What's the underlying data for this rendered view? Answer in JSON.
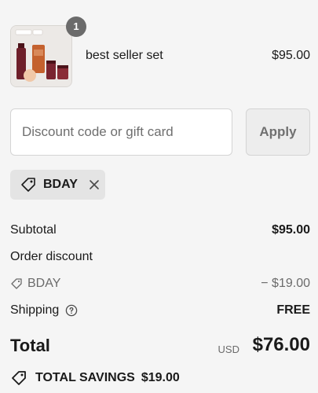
{
  "product": {
    "name": "best seller set",
    "price": "$95.00",
    "quantity": "1",
    "image_icon": "product-bundle-image"
  },
  "discount": {
    "placeholder": "Discount code or gift card",
    "value": "",
    "apply_label": "Apply"
  },
  "applied_code": {
    "code": "BDAY",
    "tag_icon": "tag-icon",
    "remove_icon": "close-icon"
  },
  "summary": {
    "subtotal_label": "Subtotal",
    "subtotal_value": "$95.00",
    "order_discount_label": "Order discount",
    "discount_code": "BDAY",
    "discount_value": "− $19.00",
    "shipping_label": "Shipping",
    "shipping_value": "FREE",
    "total_label": "Total",
    "currency": "USD",
    "total_value": "$76.00",
    "savings_label": "TOTAL SAVINGS",
    "savings_value": "$19.00"
  },
  "colors": {
    "background": "#f5f5f5",
    "chip_background": "#e4e4e4",
    "text": "#1a1a1a",
    "muted_text": "#6b6b6b",
    "product_dark": "#6e1f2a",
    "product_orange": "#c4612e"
  }
}
